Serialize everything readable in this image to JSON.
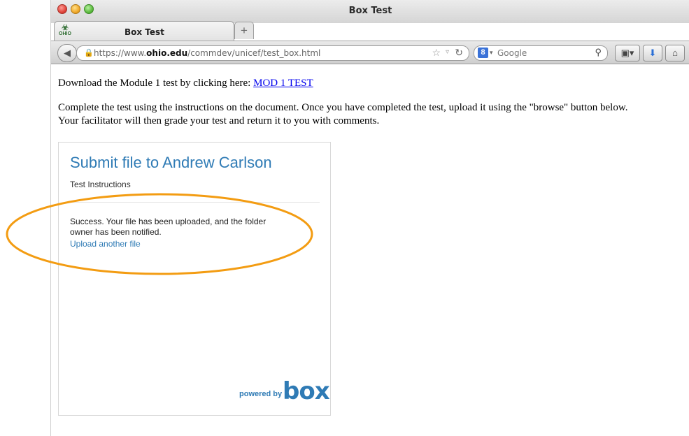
{
  "window": {
    "title": "Box Test",
    "tab_label": "Box Test",
    "tab_favicon_text": "OHIO",
    "new_tab_symbol": "+"
  },
  "toolbar": {
    "url_prefix": "https://www.",
    "url_domain": "ohio.edu",
    "url_path": "/commdev/unicef/test_box.html",
    "search_placeholder": "Google",
    "search_engine_letter": "8"
  },
  "page": {
    "download_text": "Download the Module 1 test by clicking here: ",
    "download_link": "MOD 1 TEST",
    "instructions_line1": "Complete the test using the instructions on the document. Once you have completed the test, upload it using the \"browse\" button below.",
    "instructions_line2": "Your facilitator will then grade your test and return it to you with comments."
  },
  "box_widget": {
    "title": "Submit file to Andrew Carlson",
    "instructions": "Test Instructions",
    "success_message": "Success. Your file has been uploaded, and the folder owner has been notified.",
    "upload_link": "Upload another file",
    "powered_by": "powered by",
    "logo_text": "box"
  },
  "colors": {
    "box_blue": "#2f7bb5",
    "link_blue": "#0000ee",
    "highlight_orange": "#f39c12"
  },
  "icons": [
    "back-arrow-icon",
    "lock-icon",
    "star-icon",
    "reload-icon",
    "google-icon",
    "search-icon",
    "bookmarks-icon",
    "download-icon",
    "home-icon"
  ]
}
